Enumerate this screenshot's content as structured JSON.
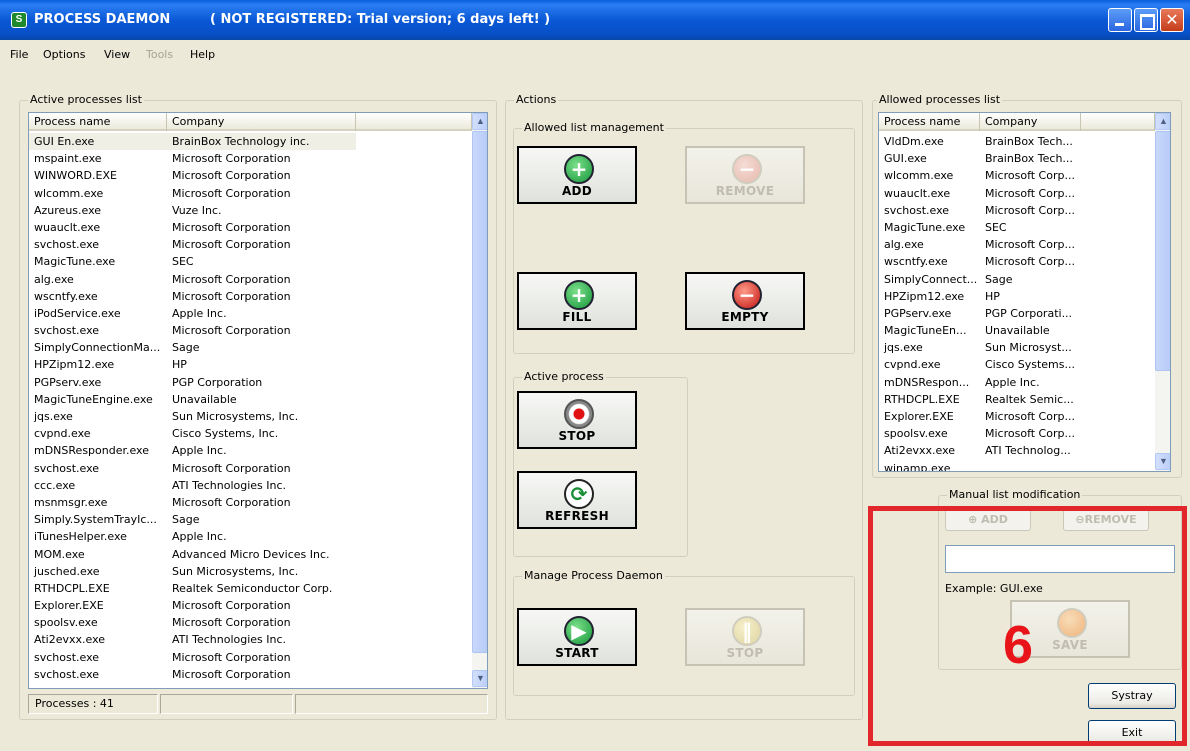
{
  "titlebar": {
    "icon": "S",
    "app_name": "PROCESS DAEMON",
    "status": "( NOT REGISTERED:  Trial version; 6 days left! )"
  },
  "menu": [
    "File",
    "Options",
    "View",
    "Tools",
    "Help"
  ],
  "active_list": {
    "title": "Active processes list",
    "columns": [
      "Process name",
      "Company"
    ],
    "rows": [
      [
        "GUI En.exe",
        "BrainBox Technology inc."
      ],
      [
        "mspaint.exe",
        "Microsoft Corporation"
      ],
      [
        "WINWORD.EXE",
        "Microsoft Corporation"
      ],
      [
        "wlcomm.exe",
        "Microsoft Corporation"
      ],
      [
        "Azureus.exe",
        "Vuze Inc."
      ],
      [
        "wuauclt.exe",
        "Microsoft Corporation"
      ],
      [
        "svchost.exe",
        "Microsoft Corporation"
      ],
      [
        "MagicTune.exe",
        "SEC"
      ],
      [
        "alg.exe",
        "Microsoft Corporation"
      ],
      [
        "wscntfy.exe",
        "Microsoft Corporation"
      ],
      [
        "iPodService.exe",
        "Apple Inc."
      ],
      [
        "svchost.exe",
        "Microsoft Corporation"
      ],
      [
        "SimplyConnectionMa...",
        "Sage"
      ],
      [
        "HPZipm12.exe",
        "HP"
      ],
      [
        "PGPserv.exe",
        "PGP Corporation"
      ],
      [
        "MagicTuneEngine.exe",
        "Unavailable"
      ],
      [
        "jqs.exe",
        "Sun Microsystems, Inc."
      ],
      [
        "cvpnd.exe",
        "Cisco Systems, Inc."
      ],
      [
        "mDNSResponder.exe",
        "Apple Inc."
      ],
      [
        "svchost.exe",
        "Microsoft Corporation"
      ],
      [
        "ccc.exe",
        "ATI Technologies Inc."
      ],
      [
        "msnmsgr.exe",
        "Microsoft Corporation"
      ],
      [
        "Simply.SystemTrayIc...",
        "Sage"
      ],
      [
        "iTunesHelper.exe",
        "Apple Inc."
      ],
      [
        "MOM.exe",
        "Advanced Micro Devices Inc."
      ],
      [
        "jusched.exe",
        "Sun Microsystems, Inc."
      ],
      [
        "RTHDCPL.EXE",
        "Realtek Semiconductor Corp."
      ],
      [
        "Explorer.EXE",
        "Microsoft Corporation"
      ],
      [
        "spoolsv.exe",
        "Microsoft Corporation"
      ],
      [
        "Ati2evxx.exe",
        "ATI Technologies Inc."
      ],
      [
        "svchost.exe",
        "Microsoft Corporation"
      ],
      [
        "svchost.exe",
        "Microsoft Corporation"
      ]
    ],
    "status": "Processes :  41"
  },
  "actions": {
    "title": "Actions",
    "allowed_mgmt": {
      "title": "Allowed list management",
      "add": "ADD",
      "remove": "REMOVE",
      "fill": "FILL",
      "empty": "EMPTY"
    },
    "active_process": {
      "title": "Active process",
      "stop": "STOP",
      "refresh": "REFRESH"
    },
    "manage": {
      "title": "Manage Process Daemon",
      "start": "START",
      "stop": "STOP"
    }
  },
  "allowed_list": {
    "title": "Allowed processes list",
    "columns": [
      "Process name",
      "Company"
    ],
    "rows": [
      [
        "VldDm.exe",
        "BrainBox Tech..."
      ],
      [
        "GUI.exe",
        "BrainBox Tech..."
      ],
      [
        "wlcomm.exe",
        "Microsoft Corp..."
      ],
      [
        "wuauclt.exe",
        "Microsoft Corp..."
      ],
      [
        "svchost.exe",
        "Microsoft Corp..."
      ],
      [
        "MagicTune.exe",
        "SEC"
      ],
      [
        "alg.exe",
        "Microsoft Corp..."
      ],
      [
        "wscntfy.exe",
        "Microsoft Corp..."
      ],
      [
        "SimplyConnect...",
        "Sage"
      ],
      [
        "HPZipm12.exe",
        "HP"
      ],
      [
        "PGPserv.exe",
        "PGP Corporati..."
      ],
      [
        "MagicTuneEn...",
        "Unavailable"
      ],
      [
        "jqs.exe",
        "Sun Microsyst..."
      ],
      [
        "cvpnd.exe",
        "Cisco Systems..."
      ],
      [
        "mDNSRespon...",
        "Apple Inc."
      ],
      [
        "RTHDCPL.EXE",
        "Realtek Semic..."
      ],
      [
        "Explorer.EXE",
        "Microsoft Corp..."
      ],
      [
        "spoolsv.exe",
        "Microsoft Corp..."
      ],
      [
        "Ati2evxx.exe",
        "ATI Technolog..."
      ],
      [
        "winamp.exe",
        ""
      ]
    ]
  },
  "manual": {
    "title": "Manual list modification",
    "add": "ADD",
    "remove": "REMOVE",
    "input_value": "",
    "example": "Example: GUI.exe",
    "save": "SAVE"
  },
  "buttons": {
    "systray": "Systray",
    "exit": "Exit"
  },
  "annotation": {
    "number": "6",
    "color": "#e1262c"
  }
}
